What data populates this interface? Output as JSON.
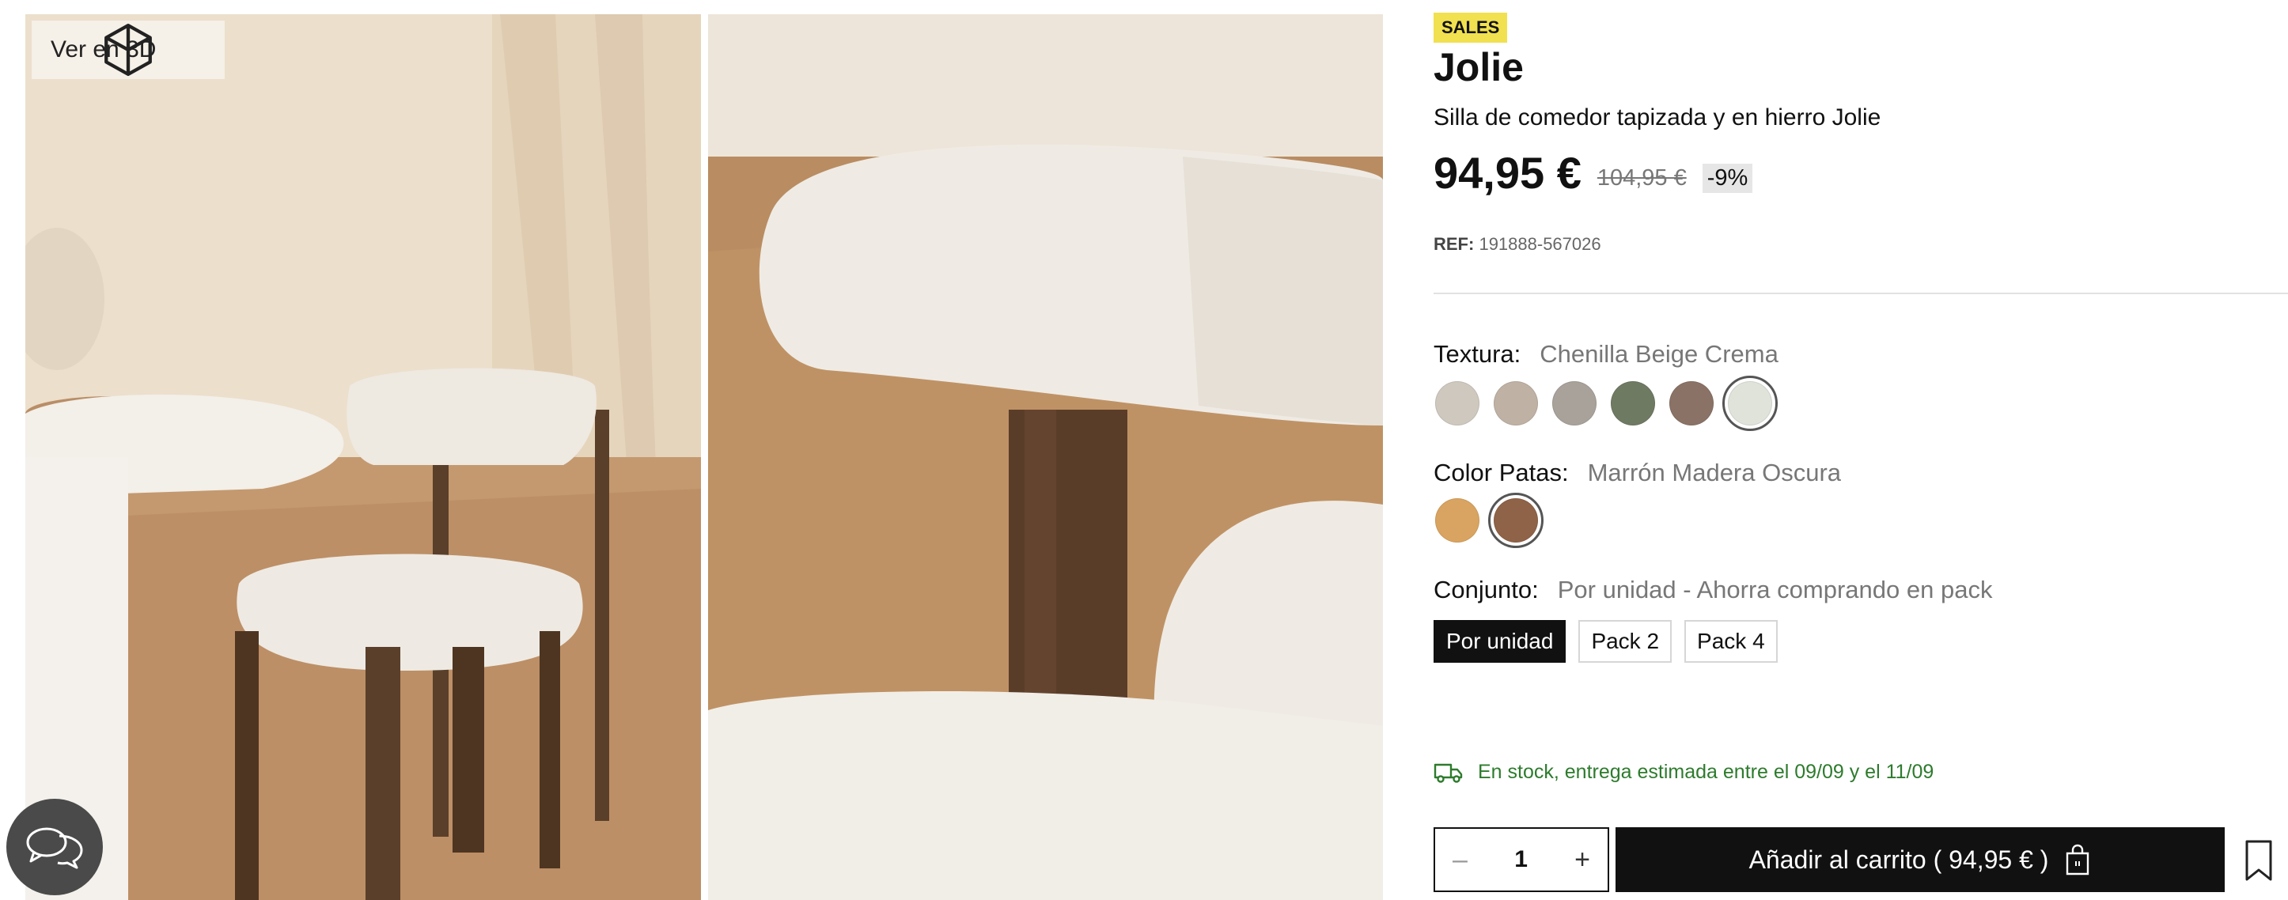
{
  "gallery": {
    "view_3d_label": "Ver en 3D",
    "view_3d_icon": "cube-icon",
    "images": [
      "chair-photo-room",
      "chair-photo-detail"
    ]
  },
  "chat": {
    "icon": "chat-bubbles-icon"
  },
  "product": {
    "badge": "SALES",
    "name": "Jolie",
    "subtitle": "Silla de comedor tapizada y en hierro Jolie",
    "price": "94,95 €",
    "old_price": "104,95 €",
    "discount": "-9%",
    "ref_label": "REF:",
    "ref_value": "191888-567026"
  },
  "options": {
    "texture": {
      "label": "Textura:",
      "value": "Chenilla Beige Crema",
      "swatches": [
        {
          "color": "#cfc8bf",
          "selected": false
        },
        {
          "color": "#bfb2a4",
          "selected": false
        },
        {
          "color": "#a9a29b",
          "selected": false
        },
        {
          "color": "#6f7a63",
          "selected": false
        },
        {
          "color": "#8a7366",
          "selected": false
        },
        {
          "color": "#dfe3da",
          "selected": true
        }
      ]
    },
    "legs": {
      "label": "Color Patas:",
      "value": "Marrón Madera Oscura",
      "swatches": [
        {
          "color": "#d9a461",
          "selected": false
        },
        {
          "color": "#8f6347",
          "selected": true
        }
      ]
    },
    "set": {
      "label": "Conjunto:",
      "value": "Por unidad - Ahorra comprando en pack",
      "packs": [
        {
          "label": "Por unidad",
          "active": true
        },
        {
          "label": "Pack 2",
          "active": false
        },
        {
          "label": "Pack 4",
          "active": false
        }
      ]
    }
  },
  "stock": {
    "icon": "truck-icon",
    "text": "En stock, entrega estimada entre el 09/09 y el 11/09",
    "color": "#2d7b2d"
  },
  "cart": {
    "qty_minus": "–",
    "qty_value": "1",
    "qty_plus": "+",
    "add_label": "Añadir al carrito ( 94,95 € )",
    "bag_icon": "shopping-bag-icon",
    "bookmark_icon": "bookmark-icon"
  },
  "colors": {
    "accent_badge": "#f1e04f",
    "primary": "#111111"
  }
}
